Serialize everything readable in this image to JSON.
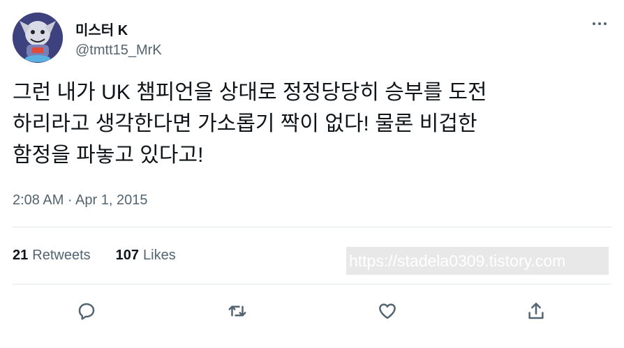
{
  "author": {
    "display_name": "미스터 K",
    "handle": "@tmtt15_MrK",
    "avatar_icon": "avatar-illustration"
  },
  "tweet": {
    "text": "그런 내가 UK 챔피언을 상대로 정정당당히 승부를 도전\n하리라고 생각한다면 가소롭기 짝이 없다! 물론 비겁한\n함정을 파놓고 있다고!",
    "timestamp": "2:08 AM · Apr 1, 2015"
  },
  "stats": {
    "retweets_count": "21",
    "retweets_label": "Retweets",
    "likes_count": "107",
    "likes_label": "Likes"
  },
  "watermark": "https://stadela0309.tistory.com",
  "actions": [
    "reply-icon",
    "retweet-icon",
    "like-icon",
    "share-icon"
  ],
  "colors": {
    "text_primary": "#0f1419",
    "text_secondary": "#536471",
    "divider": "#e1e6ea"
  }
}
